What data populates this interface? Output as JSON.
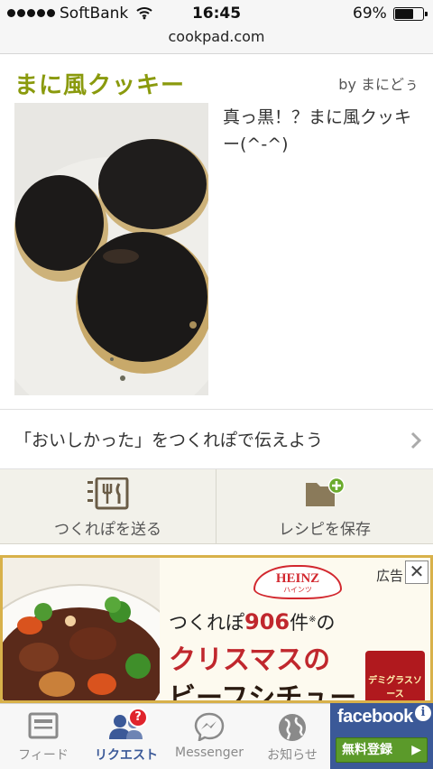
{
  "status_bar": {
    "carrier": "SoftBank",
    "time": "16:45",
    "battery_percent": "69%",
    "battery_level": 0.69
  },
  "browser": {
    "url": "cookpad.com"
  },
  "recipe": {
    "title": "まに風クッキー",
    "author": "by まにどぅ",
    "description": "真っ黒！？まに風クッキー(^-^)"
  },
  "report_prompt": {
    "text": "「おいしかった」をつくれぽで伝えよう"
  },
  "actions": {
    "send_report": "つくれぽを送る",
    "save_recipe": "レシピを保存"
  },
  "ad": {
    "brand": "HEINZ",
    "brand_sub": "ハインツ",
    "label": "広告",
    "close": "✕",
    "line1_prefix": "つくれぽ",
    "line1_count": "906",
    "line1_suffix": "件",
    "line1_mark": "※",
    "line1_tail": "の",
    "line2": "クリスマスの",
    "line3": "ビーフシチュー",
    "product": "デミグラスソース"
  },
  "bottom_nav": {
    "tabs": [
      {
        "label": "フィード",
        "icon": "feed-icon"
      },
      {
        "label": "リクエスト",
        "icon": "friend-requests-icon",
        "badge": "?"
      },
      {
        "label": "Messenger",
        "icon": "messenger-icon"
      },
      {
        "label": "お知らせ",
        "icon": "globe-icon"
      }
    ],
    "active_tab": "リクエスト"
  },
  "facebook_ad": {
    "brand": "facebook",
    "button": "無料登録",
    "button_arrow": "▶",
    "info": "i"
  }
}
